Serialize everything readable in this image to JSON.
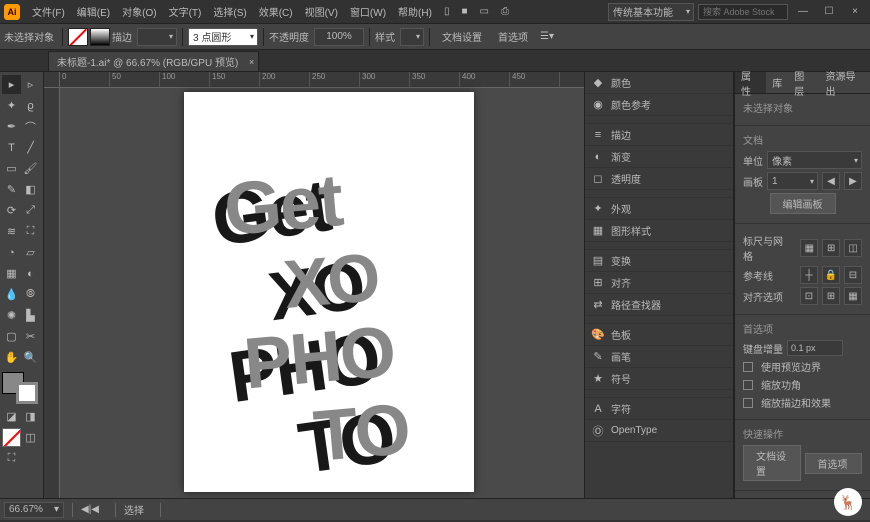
{
  "app": {
    "name": "Ai"
  },
  "menu": [
    "文件(F)",
    "编辑(E)",
    "对象(O)",
    "文字(T)",
    "选择(S)",
    "效果(C)",
    "视图(V)",
    "窗口(W)",
    "帮助(H)"
  ],
  "menu_extra_icons": [
    "▯",
    "■",
    "▭",
    "⎙"
  ],
  "title_right": {
    "label": "传统基本功能",
    "search_placeholder": "搜索 Adobe Stock"
  },
  "win": [
    "—",
    "☐",
    "×"
  ],
  "control": {
    "no_sel": "未选择对象",
    "stroke_label": "描边",
    "stroke_val": "",
    "brush_val": "3 点圆形",
    "opacity_label": "不透明度",
    "opacity_val": "100%",
    "style_label": "样式",
    "docset": "文档设置",
    "prefs": "首选项"
  },
  "doc": {
    "tab": "未标题-1.ai* @ 66.67% (RGB/GPU 预览)"
  },
  "ruler": [
    "0",
    "50",
    "100",
    "150",
    "200",
    "250",
    "300",
    "350",
    "400",
    "450"
  ],
  "art": {
    "l1": "Get",
    "l2": "XO",
    "l3": "PHO",
    "l4": "TO"
  },
  "panels": [
    {
      "icon": "◆",
      "label": "颜色"
    },
    {
      "icon": "◉",
      "label": "颜色参考"
    },
    {
      "gap": true
    },
    {
      "icon": "≡",
      "label": "描边"
    },
    {
      "icon": "◐",
      "label": "渐变"
    },
    {
      "icon": "◻",
      "label": "透明度"
    },
    {
      "gap": true
    },
    {
      "icon": "✦",
      "label": "外观"
    },
    {
      "icon": "▦",
      "label": "图形样式"
    },
    {
      "gap": true
    },
    {
      "icon": "▤",
      "label": "变换"
    },
    {
      "icon": "⊞",
      "label": "对齐"
    },
    {
      "icon": "⇄",
      "label": "路径查找器"
    },
    {
      "gap": true
    },
    {
      "icon": "🎨",
      "label": "色板"
    },
    {
      "icon": "✎",
      "label": "画笔"
    },
    {
      "icon": "★",
      "label": "符号"
    },
    {
      "gap": true
    },
    {
      "icon": "A",
      "label": "字符"
    },
    {
      "icon": "Ⓞ",
      "label": "OpenType"
    }
  ],
  "rp": {
    "tabs": [
      "属性",
      "库",
      "图层",
      "资源导出"
    ],
    "no_sel": "未选择对象",
    "doc_sec": "文档",
    "unit_label": "单位",
    "unit_val": "像素",
    "artboard_label": "画板",
    "artboard_val": "1",
    "edit_artboard": "编辑画板",
    "ruler_grid": "标尺与网格",
    "guides": "参考线",
    "snap": "对齐选项",
    "prefs": "首选项",
    "key_inc_label": "键盘增量",
    "key_inc_val": "0.1 px",
    "chk1": "使用预览边界",
    "chk2": "缩放功角",
    "chk3": "缩放描边和效果",
    "quick": "快速操作",
    "b1": "文档设置",
    "b2": "首选项"
  },
  "status": {
    "zoom": "66.67%",
    "sel": "选择"
  }
}
